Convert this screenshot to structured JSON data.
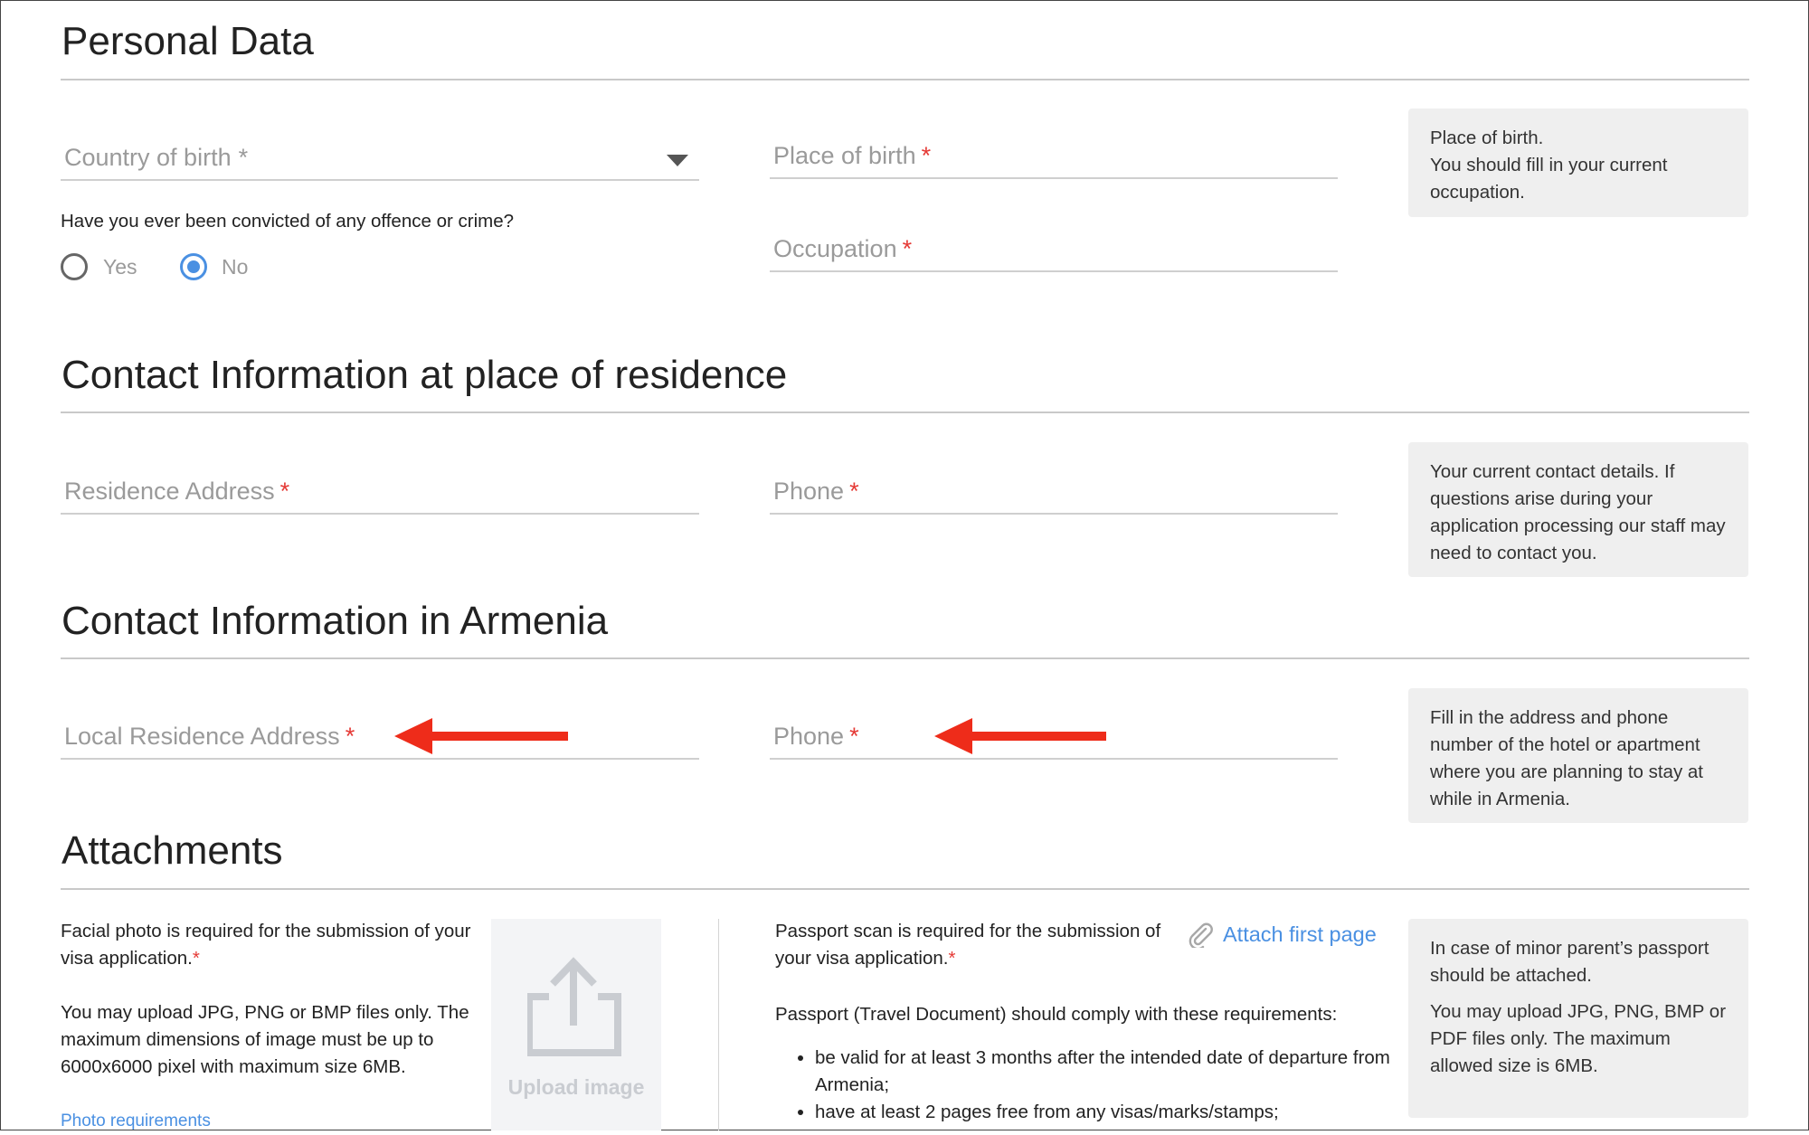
{
  "sections": {
    "personal_data": "Personal Data",
    "contact_residence": "Contact Information at place of residence",
    "contact_armenia": "Contact Information in Armenia",
    "attachments": "Attachments"
  },
  "personal": {
    "country_of_birth": {
      "label": "Country of birth",
      "asterisk": "*"
    },
    "place_of_birth": {
      "label": "Place of birth",
      "asterisk": "*"
    },
    "occupation": {
      "label": "Occupation",
      "asterisk": "*"
    },
    "question": "Have you ever been convicted of any offence or crime?",
    "radio": {
      "yes": "Yes",
      "no": "No",
      "selected": "No"
    },
    "note_lines": [
      "Place of birth.",
      "You should fill in your current occupation."
    ]
  },
  "residence": {
    "address": {
      "label": "Residence Address",
      "asterisk": "*"
    },
    "phone": {
      "label": "Phone",
      "asterisk": "*"
    },
    "note": "Your current contact details. If questions arise during your application processing our staff may need to contact you."
  },
  "armenia": {
    "address": {
      "label": "Local Residence Address",
      "asterisk": "*"
    },
    "phone": {
      "label": "Phone",
      "asterisk": "*"
    },
    "note": "Fill in the address and phone number of the hotel or apartment where you are planning to stay at while in Armenia."
  },
  "attachments": {
    "photo_required": "Facial photo is required for the submission of your visa application.",
    "photo_asterisk": "*",
    "photo_formats": "You may upload JPG, PNG or BMP files only. The maximum dimensions of image must be up to 6000x6000 pixel with maximum size 6MB.",
    "photo_requirements_link": "Photo requirements",
    "upload_label": "Upload image",
    "passport_required": "Passport scan is required for the submission of your visa application.",
    "passport_asterisk": "*",
    "attach_first_page": "Attach first page",
    "passport_requirements_intro": "Passport (Travel Document) should comply with these requirements:",
    "passport_requirements": [
      "be valid for at least 3 months after the intended date of departure from Armenia;",
      "have at least 2 pages free from any visas/marks/stamps;"
    ],
    "note_minor": "In case of minor parent’s passport should be attached.",
    "note_formats": "You may upload JPG, PNG, BMP or PDF files only. The maximum allowed size is 6MB."
  },
  "colors": {
    "accent": "#4a90e2",
    "required": "#e53935",
    "annotation_arrow": "#ee2c1a"
  }
}
